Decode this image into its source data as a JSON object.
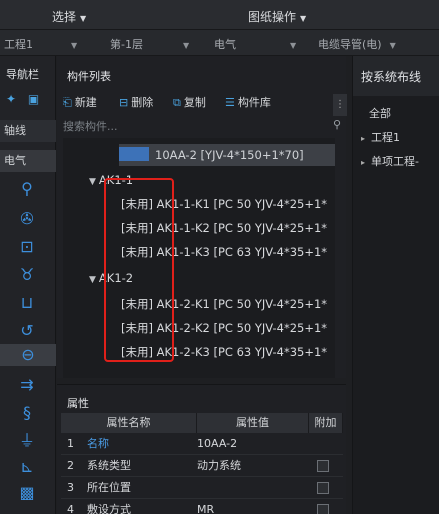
{
  "menubar": {
    "select_label": "选择",
    "drawing_ops_label": "图纸操作"
  },
  "filterbar": {
    "project": "工程1",
    "floor": "第-1层",
    "discipline": "电气",
    "category": "电缆导管(电)"
  },
  "nav": {
    "title": "导航栏",
    "tab_axis": "轴线",
    "tab_electrical": "电气"
  },
  "component_list": {
    "title": "构件列表",
    "toolbar": {
      "new_label": "新建",
      "delete_label": "删除",
      "copy_label": "复制",
      "library_label": "构件库"
    },
    "search_placeholder": "搜索构件...",
    "selected_item": "10AA-2 [YJV-4*150+1*70]",
    "groups": [
      {
        "name": "AK1-1",
        "items": [
          "[未用] AK1-1-K1 [PC 50 YJV-4*25+1*",
          "[未用] AK1-1-K2 [PC 50 YJV-4*25+1*",
          "[未用] AK1-1-K3 [PC 63 YJV-4*35+1*"
        ]
      },
      {
        "name": "AK1-2",
        "items": [
          "[未用] AK1-2-K1 [PC 50 YJV-4*25+1*",
          "[未用] AK1-2-K2 [PC 50 YJV-4*25+1*",
          "[未用] AK1-2-K3 [PC 63 YJV-4*35+1*"
        ]
      }
    ]
  },
  "properties": {
    "title": "属性",
    "headers": [
      "属性名称",
      "属性值",
      "附加"
    ],
    "rows": [
      {
        "num": "1",
        "name": "名称",
        "value": "10AA-2"
      },
      {
        "num": "2",
        "name": "系统类型",
        "value": "动力系统"
      },
      {
        "num": "3",
        "name": "所在位置",
        "value": ""
      },
      {
        "num": "4",
        "name": "敷设方式",
        "value": "MR"
      }
    ]
  },
  "right_panel": {
    "title": "按系统布线",
    "items": [
      "全部",
      "工程1",
      "单项工程-"
    ]
  },
  "colors": {
    "accent_blue": "#3d8fdc",
    "highlight_red": "#e0201a"
  }
}
